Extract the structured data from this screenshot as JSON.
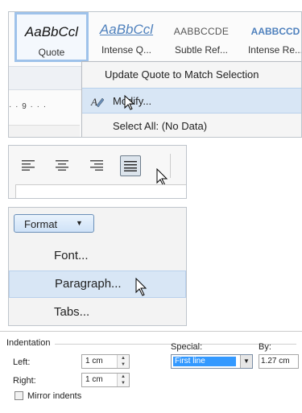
{
  "styles_gallery": {
    "tiles": [
      {
        "sample": "AaBbCcl",
        "name": "Quote"
      },
      {
        "sample": "AaBbCcl",
        "name": "Intense Q..."
      },
      {
        "sample": "AABBCCDE",
        "name": "Subtle Ref..."
      },
      {
        "sample": "AABBCCD",
        "name": "Intense Re..."
      }
    ],
    "ruler_text": "· · 9 · · ·"
  },
  "context_menu": {
    "update": "Update Quote to Match Selection",
    "modify": "Modify...",
    "select_all": "Select All: (No Data)"
  },
  "format_menu": {
    "button": "Format",
    "items": [
      "Font...",
      "Paragraph...",
      "Tabs..."
    ]
  },
  "indentation": {
    "title": "Indentation",
    "left_label": "Left:",
    "left_value": "1 cm",
    "right_label": "Right:",
    "right_value": "1 cm",
    "special_label": "Special:",
    "special_value": "First line",
    "by_label": "By:",
    "by_value": "1.27 cm",
    "mirror_label": "Mirror indents"
  }
}
